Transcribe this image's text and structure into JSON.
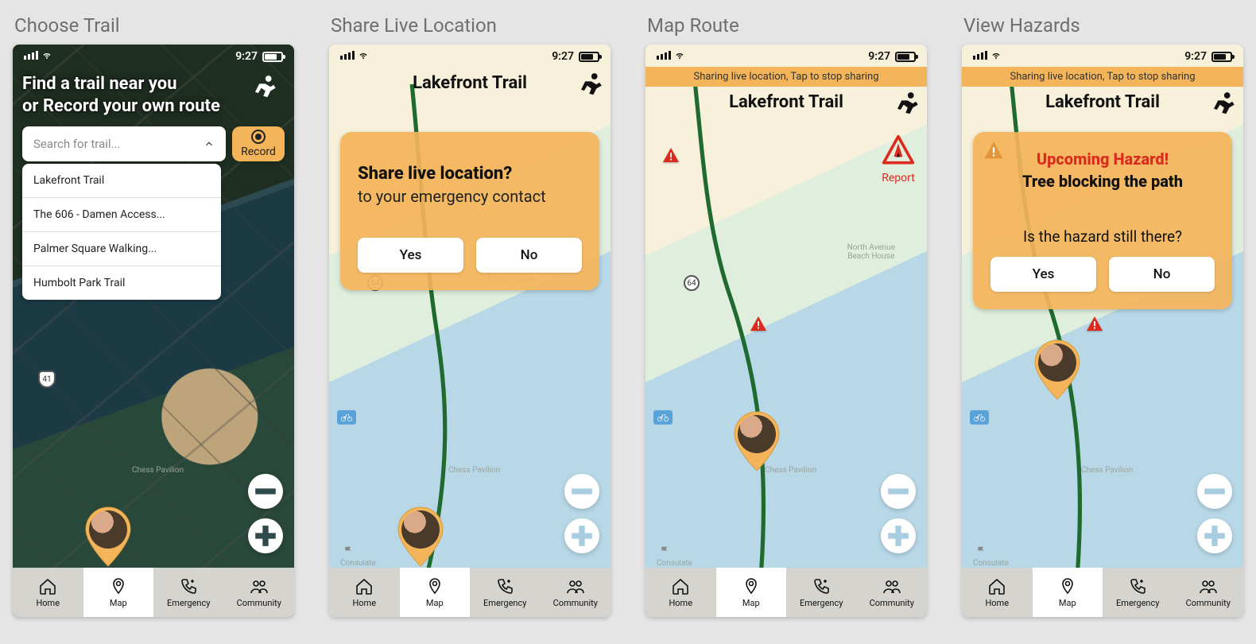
{
  "status": {
    "time": "9:27"
  },
  "tabs": {
    "home": "Home",
    "map": "Map",
    "emergency": "Emergency",
    "community": "Community"
  },
  "zoom": {
    "in": "+",
    "out": "−"
  },
  "screens": {
    "choose": {
      "title": "Choose Trail",
      "heading_l1": "Find a trail near you",
      "heading_l2": "or Record your own route",
      "search_placeholder": "Search for trail...",
      "record": "Record",
      "trails": [
        "Lakefront Trail",
        "The 606 - Damen Access...",
        "Palmer Square Walking...",
        "Humbolt Park Trail"
      ]
    },
    "share": {
      "title": "Share Live Location",
      "trail": "Lakefront Trail",
      "question": "Share live location?",
      "sub": "to your emergency contact",
      "yes": "Yes",
      "no": "No"
    },
    "route": {
      "title": "Map Route",
      "banner": "Sharing live location, Tap to stop sharing",
      "trail": "Lakefront Trail",
      "report": "Report"
    },
    "hazard": {
      "title": "View Hazards",
      "banner": "Sharing live location, Tap to stop sharing",
      "trail": "Lakefront Trail",
      "alert": "Upcoming Hazard!",
      "detail": "Tree blocking the path",
      "question": "Is the hazard still there?",
      "yes": "Yes",
      "no": "No"
    }
  },
  "map_labels": {
    "chess": "Chess Pavilion",
    "north_l1": "North Avenue",
    "north_l2": "Beach House",
    "beach": "Beach House",
    "r41": "41",
    "r64": "64",
    "consulate": "Consulate"
  }
}
